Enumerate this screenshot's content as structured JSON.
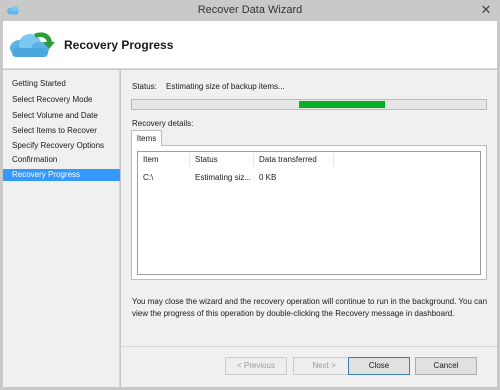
{
  "window": {
    "title": "Recover Data Wizard",
    "close_glyph": "✕",
    "icon": "cloud-icon"
  },
  "header": {
    "title": "Recovery Progress",
    "logo_icon": "cloud-recovery-icon"
  },
  "nav": {
    "items": [
      {
        "label": "Getting Started"
      },
      {
        "label": "Select Recovery Mode"
      },
      {
        "label": "Select Volume and Date"
      },
      {
        "label": "Select Items to Recover"
      },
      {
        "label": "Specify Recovery Options"
      },
      {
        "label": "Confirmation"
      },
      {
        "label": "Recovery Progress"
      }
    ],
    "active_index": 6,
    "active_color": "#3399ff"
  },
  "status": {
    "label": "Status:",
    "value": "Estimating size of backup items..."
  },
  "progress": {
    "indeterminate": true,
    "fill_color": "#06b025"
  },
  "details": {
    "label": "Recovery details:",
    "tab_label": "Items",
    "columns": [
      "Item",
      "Status",
      "Data transferred"
    ],
    "rows": [
      [
        "C:\\",
        "Estimating siz...",
        "0 KB"
      ]
    ]
  },
  "info_text": "You may close the wizard and the recovery operation will continue to run in the background. You can view the progress of this operation by double-clicking the Recovery message in dashboard.",
  "buttons": {
    "previous": "< Previous",
    "next": "Next >",
    "close": "Close",
    "cancel": "Cancel"
  }
}
